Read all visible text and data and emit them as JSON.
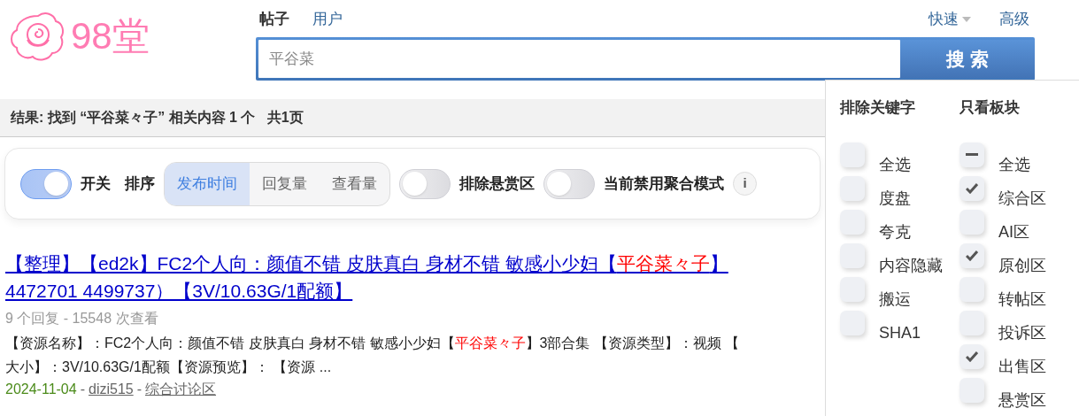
{
  "logo": {
    "text": "98堂"
  },
  "search_tabs": [
    {
      "label": "帖子",
      "selected": true
    },
    {
      "label": "用户",
      "selected": false
    }
  ],
  "search_links": [
    {
      "label": "快速",
      "dropdown": true
    },
    {
      "label": "高级",
      "dropdown": false
    }
  ],
  "search": {
    "value": "平谷菜",
    "button": "搜 索"
  },
  "result_summary": "结果: 找到 “平谷菜々子” 相关内容 1 个   共1页",
  "toolbar": {
    "switch": {
      "on": true,
      "label": "开关"
    },
    "sort_label": "排序",
    "sort_options": [
      {
        "label": "发布时间",
        "selected": true
      },
      {
        "label": "回复量",
        "selected": false
      },
      {
        "label": "查看量",
        "selected": false
      }
    ],
    "toggles": [
      {
        "on": false,
        "label": "排除悬赏区"
      },
      {
        "on": false,
        "label": "当前禁用聚合模式"
      }
    ],
    "info": "i"
  },
  "results": [
    {
      "title_lines": [
        [
          {
            "text": "【整理】【ed2k】FC2个人向：颜值不错 皮肤真白 身材不错 敏感小少妇【",
            "highlight": false
          },
          {
            "text": "平谷菜々子",
            "highlight": true
          },
          {
            "text": "】",
            "highlight": false
          }
        ],
        [
          {
            "text": "4472701 4499737）【3V/10.63G/1配额】",
            "highlight": false
          }
        ]
      ],
      "meta": "9 个回复 - 15548 次查看",
      "excerpt_lines": [
        [
          {
            "text": "【资源名称】：FC2个人向：颜值不错 皮肤真白 身材不错 敏感小少妇【",
            "highlight": false
          },
          {
            "text": "平谷菜々子",
            "highlight": true
          },
          {
            "text": "】3部合集 【资源类型】：视频 【",
            "highlight": false
          }
        ],
        [
          {
            "text": "大小】：3V/10.63G/1配额【资源预览】：  【资源 ...",
            "highlight": false
          }
        ]
      ],
      "date": "2024-11-04",
      "separators": [
        "-",
        "-"
      ],
      "author": "dizi515",
      "forum": "综合讨论区"
    }
  ],
  "filter_panel": {
    "exclude": {
      "title": "排除关键字",
      "options": [
        {
          "label": "全选",
          "checked": false
        },
        {
          "label": "度盘",
          "checked": false
        },
        {
          "label": "夸克",
          "checked": false
        },
        {
          "label": "内容隐藏",
          "checked": false
        },
        {
          "label": "搬运",
          "checked": false
        },
        {
          "label": "SHA1",
          "checked": false
        }
      ]
    },
    "boards": {
      "title": "只看板块",
      "options": [
        {
          "label": "全选",
          "checked": false,
          "indeterminate": true
        },
        {
          "label": "综合区",
          "checked": true
        },
        {
          "label": "AI区",
          "checked": false
        },
        {
          "label": "原创区",
          "checked": true
        },
        {
          "label": "转帖区",
          "checked": false
        },
        {
          "label": "投诉区",
          "checked": false
        },
        {
          "label": "出售区",
          "checked": true
        },
        {
          "label": "悬赏区",
          "checked": false
        }
      ]
    }
  }
}
